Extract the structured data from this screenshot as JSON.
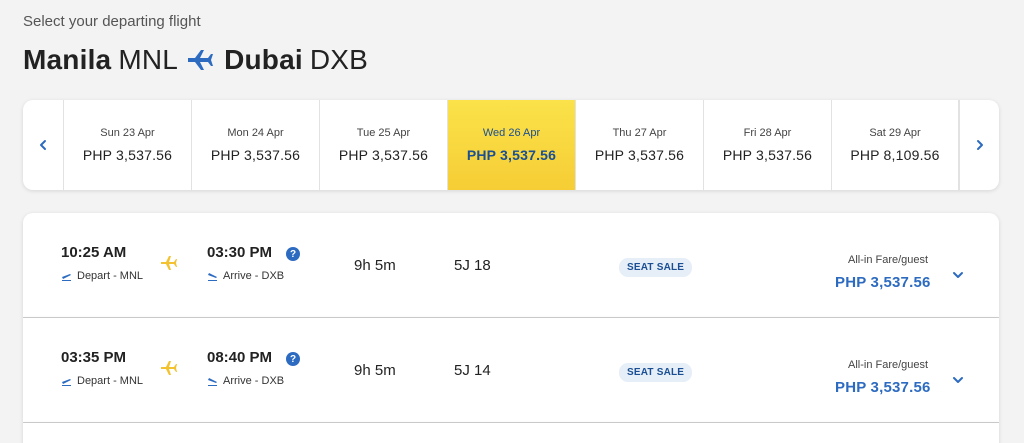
{
  "header": {
    "subtitle": "Select your departing flight",
    "origin_city": "Manila",
    "origin_code": "MNL",
    "dest_city": "Dubai",
    "dest_code": "DXB"
  },
  "date_strip": {
    "prev_icon": "chevron-left-icon",
    "next_icon": "chevron-right-icon",
    "dates": [
      {
        "day": "Sun 23 Apr",
        "price": "PHP 3,537.56",
        "selected": false
      },
      {
        "day": "Mon 24 Apr",
        "price": "PHP 3,537.56",
        "selected": false
      },
      {
        "day": "Tue 25 Apr",
        "price": "PHP 3,537.56",
        "selected": false
      },
      {
        "day": "Wed 26 Apr",
        "price": "PHP 3,537.56",
        "selected": true
      },
      {
        "day": "Thu 27 Apr",
        "price": "PHP 3,537.56",
        "selected": false
      },
      {
        "day": "Fri 28 Apr",
        "price": "PHP 3,537.56",
        "selected": false
      },
      {
        "day": "Sat 29 Apr",
        "price": "PHP 8,109.56",
        "selected": false
      }
    ]
  },
  "flights": [
    {
      "depart_time": "10:25 AM",
      "depart_label": "Depart - MNL",
      "arrive_time": "03:30 PM",
      "arrive_label": "Arrive - DXB",
      "info_icon": "?",
      "duration": "9h 5m",
      "flight_no": "5J 18",
      "badge": "SEAT SALE",
      "fare_label": "All-in Fare/guest",
      "fare_price": "PHP 3,537.56"
    },
    {
      "depart_time": "03:35 PM",
      "depart_label": "Depart - MNL",
      "arrive_time": "08:40 PM",
      "arrive_label": "Arrive - DXB",
      "info_icon": "?",
      "duration": "9h 5m",
      "flight_no": "5J 14",
      "badge": "SEAT SALE",
      "fare_label": "All-in Fare/guest",
      "fare_price": "PHP 3,537.56"
    }
  ],
  "colors": {
    "accent_blue": "#2d6bc1",
    "selected_yellow": "#f6cd35",
    "plane_yellow": "#f2c230"
  }
}
